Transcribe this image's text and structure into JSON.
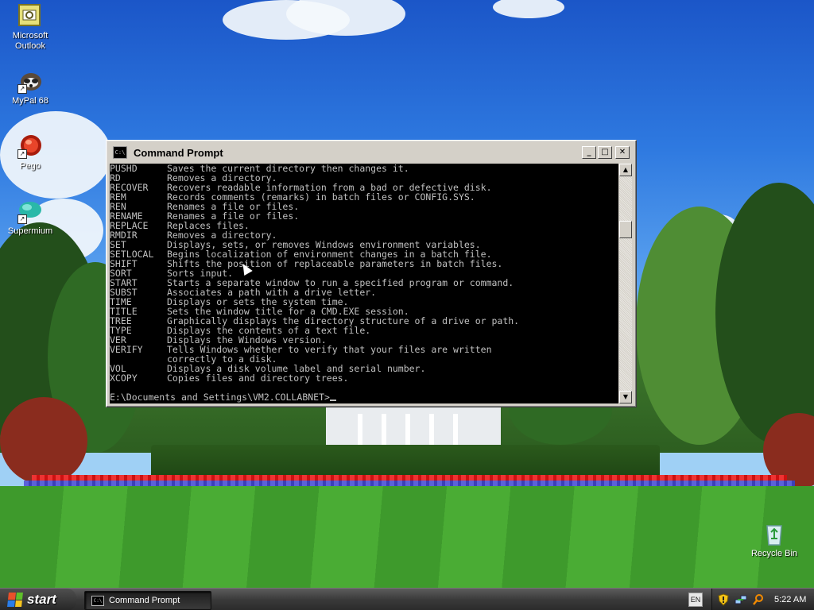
{
  "desktop": {
    "icons": [
      {
        "label": "Microsoft Outlook",
        "icon": "outlook-icon"
      },
      {
        "label": "MyPal 68",
        "icon": "mypal-icon"
      },
      {
        "label": "Pego",
        "icon": "pego-icon"
      },
      {
        "label": "Supermium",
        "icon": "supermium-icon"
      },
      {
        "label": "Recycle Bin",
        "icon": "recycle-bin-icon"
      }
    ]
  },
  "window": {
    "title": "Command Prompt",
    "icon_text": "C:\\",
    "buttons": {
      "minimize": "_",
      "maximize": "□",
      "close": "✕"
    },
    "console_lines": [
      {
        "cmd": "PUSHD",
        "desc": "Saves the current directory then changes it."
      },
      {
        "cmd": "RD",
        "desc": "Removes a directory."
      },
      {
        "cmd": "RECOVER",
        "desc": "Recovers readable information from a bad or defective disk."
      },
      {
        "cmd": "REM",
        "desc": "Records comments (remarks) in batch files or CONFIG.SYS."
      },
      {
        "cmd": "REN",
        "desc": "Renames a file or files."
      },
      {
        "cmd": "RENAME",
        "desc": "Renames a file or files."
      },
      {
        "cmd": "REPLACE",
        "desc": "Replaces files."
      },
      {
        "cmd": "RMDIR",
        "desc": "Removes a directory."
      },
      {
        "cmd": "SET",
        "desc": "Displays, sets, or removes Windows environment variables."
      },
      {
        "cmd": "SETLOCAL",
        "desc": "Begins localization of environment changes in a batch file."
      },
      {
        "cmd": "SHIFT",
        "desc": "Shifts the position of replaceable parameters in batch files."
      },
      {
        "cmd": "SORT",
        "desc": "Sorts input."
      },
      {
        "cmd": "START",
        "desc": "Starts a separate window to run a specified program or command."
      },
      {
        "cmd": "SUBST",
        "desc": "Associates a path with a drive letter."
      },
      {
        "cmd": "TIME",
        "desc": "Displays or sets the system time."
      },
      {
        "cmd": "TITLE",
        "desc": "Sets the window title for a CMD.EXE session."
      },
      {
        "cmd": "TREE",
        "desc": "Graphically displays the directory structure of a drive or path."
      },
      {
        "cmd": "TYPE",
        "desc": "Displays the contents of a text file."
      },
      {
        "cmd": "VER",
        "desc": "Displays the Windows version."
      },
      {
        "cmd": "VERIFY",
        "desc": "Tells Windows whether to verify that your files are written"
      },
      {
        "cmd": "",
        "desc": "correctly to a disk."
      },
      {
        "cmd": "VOL",
        "desc": "Displays a disk volume label and serial number."
      },
      {
        "cmd": "XCOPY",
        "desc": "Copies files and directory trees."
      }
    ],
    "prompt": "E:\\Documents and Settings\\VM2.COLLABNET>"
  },
  "taskbar": {
    "start_label": "start",
    "task_items": [
      {
        "label": "Command Prompt",
        "icon": "cmd-icon"
      }
    ],
    "language": "EN",
    "tray_icons": [
      "security-shield-icon",
      "network-icon",
      "search-icon"
    ],
    "clock": "5:22 AM"
  }
}
